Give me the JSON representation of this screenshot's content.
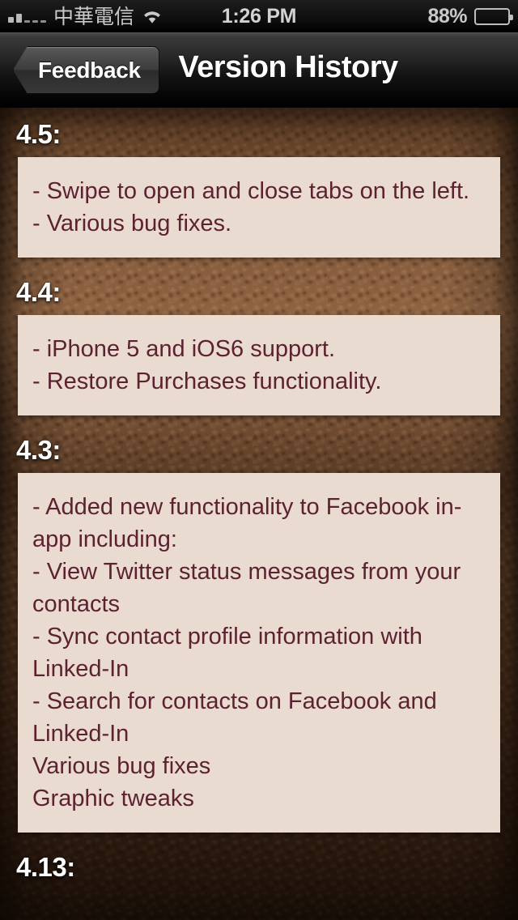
{
  "status_bar": {
    "carrier": "中華電信",
    "time": "1:26 PM",
    "battery_percent": "88%",
    "signal_icon": "signal-bars-icon",
    "wifi_icon": "wifi-icon",
    "battery_icon": "battery-icon"
  },
  "nav_bar": {
    "back_label": "Feedback",
    "title": "Version History"
  },
  "sections": [
    {
      "version": "4.5:",
      "lines": [
        "- Swipe to open and close tabs on the left.",
        "- Various bug fixes."
      ]
    },
    {
      "version": "4.4:",
      "lines": [
        "- iPhone 5 and iOS6 support.",
        "- Restore Purchases functionality."
      ]
    },
    {
      "version": "4.3:",
      "lines": [
        "- Added new functionality to Facebook in-app including:",
        "- View Twitter status messages from your contacts",
        "- Sync contact profile information with Linked-In",
        "- Search for contacts on Facebook and Linked-In",
        "Various bug fixes",
        "Graphic tweaks"
      ]
    },
    {
      "version": "4.13:",
      "lines": []
    }
  ],
  "colors": {
    "panel_background": "#eadbd1",
    "panel_text": "#5c2230",
    "heading_text": "#ffffff",
    "leather_brown": "#8a6040",
    "nav_bar_dark": "#131313"
  }
}
